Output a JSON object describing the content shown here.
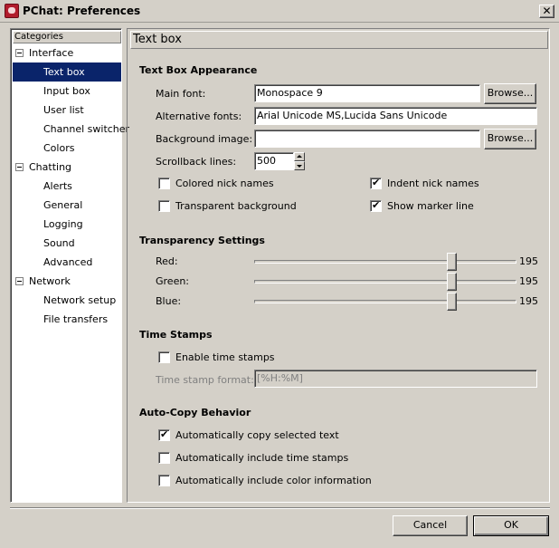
{
  "window": {
    "title": "PChat: Preferences",
    "close_glyph": "✕"
  },
  "tree": {
    "header": "Categories",
    "items": [
      {
        "label": "Interface",
        "level": "parent"
      },
      {
        "label": "Text box",
        "level": "child",
        "selected": true
      },
      {
        "label": "Input box",
        "level": "child"
      },
      {
        "label": "User list",
        "level": "child"
      },
      {
        "label": "Channel switcher",
        "level": "child"
      },
      {
        "label": "Colors",
        "level": "child"
      },
      {
        "label": "Chatting",
        "level": "parent"
      },
      {
        "label": "Alerts",
        "level": "child"
      },
      {
        "label": "General",
        "level": "child"
      },
      {
        "label": "Logging",
        "level": "child"
      },
      {
        "label": "Sound",
        "level": "child"
      },
      {
        "label": "Advanced",
        "level": "child"
      },
      {
        "label": "Network",
        "level": "parent"
      },
      {
        "label": "Network setup",
        "level": "child"
      },
      {
        "label": "File transfers",
        "level": "child"
      }
    ]
  },
  "page_title": "Text box",
  "appearance": {
    "title": "Text Box Appearance",
    "main_font_label": "Main font:",
    "main_font_value": "Monospace 9",
    "alt_fonts_label": "Alternative fonts:",
    "alt_fonts_value": "Arial Unicode MS,Lucida Sans Unicode",
    "bg_image_label": "Background image:",
    "bg_image_value": "",
    "browse_label": "Browse...",
    "scrollback_label": "Scrollback lines:",
    "scrollback_value": "500",
    "colored_nick": {
      "label": "Colored nick names",
      "checked": false
    },
    "indent_nick": {
      "label": "Indent nick names",
      "checked": true
    },
    "transparent_bg": {
      "label": "Transparent background",
      "checked": false
    },
    "marker_line": {
      "label": "Show marker line",
      "checked": true
    }
  },
  "transparency": {
    "title": "Transparency Settings",
    "red_label": "Red:",
    "red_value": "195",
    "green_label": "Green:",
    "green_value": "195",
    "blue_label": "Blue:",
    "blue_value": "195",
    "max": 255
  },
  "timestamps": {
    "title": "Time Stamps",
    "enable": {
      "label": "Enable time stamps",
      "checked": false
    },
    "format_label": "Time stamp format:",
    "format_value": "[%H:%M]"
  },
  "autocopy": {
    "title": "Auto-Copy Behavior",
    "copy_selected": {
      "label": "Automatically copy selected text",
      "checked": true
    },
    "include_timestamps": {
      "label": "Automatically include time stamps",
      "checked": false
    },
    "include_color": {
      "label": "Automatically include color information",
      "checked": false
    }
  },
  "buttons": {
    "cancel": "Cancel",
    "ok": "OK"
  }
}
